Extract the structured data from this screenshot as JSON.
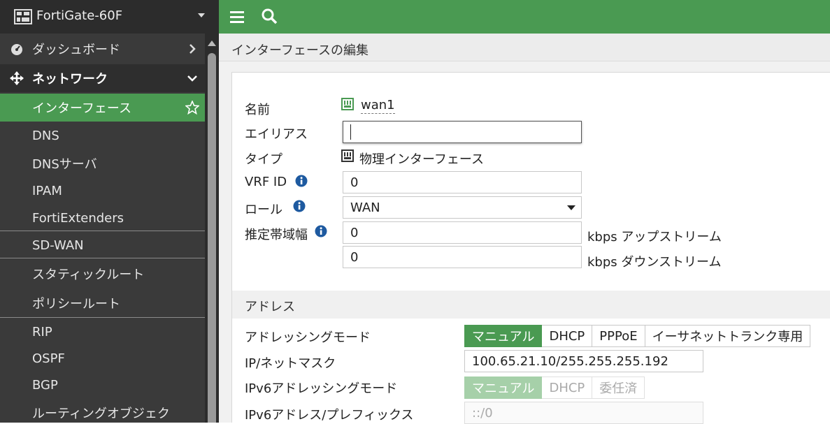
{
  "device": {
    "name": "FortiGate-60F"
  },
  "sidebar": {
    "items": [
      {
        "label": "ダッシュボード"
      },
      {
        "label": "ネットワーク"
      },
      {
        "label": "インターフェース"
      },
      {
        "label": "DNS"
      },
      {
        "label": "DNSサーバ"
      },
      {
        "label": "IPAM"
      },
      {
        "label": "FortiExtenders"
      },
      {
        "label": "SD-WAN"
      },
      {
        "label": "スタティックルート"
      },
      {
        "label": "ポリシールート"
      },
      {
        "label": "RIP"
      },
      {
        "label": "OSPF"
      },
      {
        "label": "BGP"
      },
      {
        "label": "ルーティングオブジェク"
      }
    ]
  },
  "page": {
    "title": "インターフェースの編集"
  },
  "form": {
    "name_label": "名前",
    "name_value": "wan1",
    "alias_label": "エイリアス",
    "alias_value": "",
    "type_label": "タイプ",
    "type_value": "物理インターフェース",
    "vrf_label": "VRF ID",
    "vrf_value": "0",
    "role_label": "ロール",
    "role_value": "WAN",
    "bw_label": "推定帯域幅",
    "bw_up_value": "0",
    "bw_up_unit": "kbps アップストリーム",
    "bw_down_value": "0",
    "bw_down_unit": "kbps ダウンストリーム"
  },
  "address": {
    "section_title": "アドレス",
    "mode_label": "アドレッシングモード",
    "mode_options": [
      "マニュアル",
      "DHCP",
      "PPPoE",
      "イーサネットトランク専用"
    ],
    "mode_selected": "マニュアル",
    "ip_label": "IP/ネットマスク",
    "ip_value": "100.65.21.10/255.255.255.192",
    "ipv6_mode_label": "IPv6アドレッシングモード",
    "ipv6_mode_options": [
      "マニュアル",
      "DHCP",
      "委任済"
    ],
    "ipv6_mode_selected": "マニュアル",
    "ipv6_label": "IPv6アドレス/プレフィックス",
    "ipv6_value": "::/0"
  },
  "colors": {
    "accent": "#4a9a52",
    "sidebar": "#3a3a3a"
  }
}
